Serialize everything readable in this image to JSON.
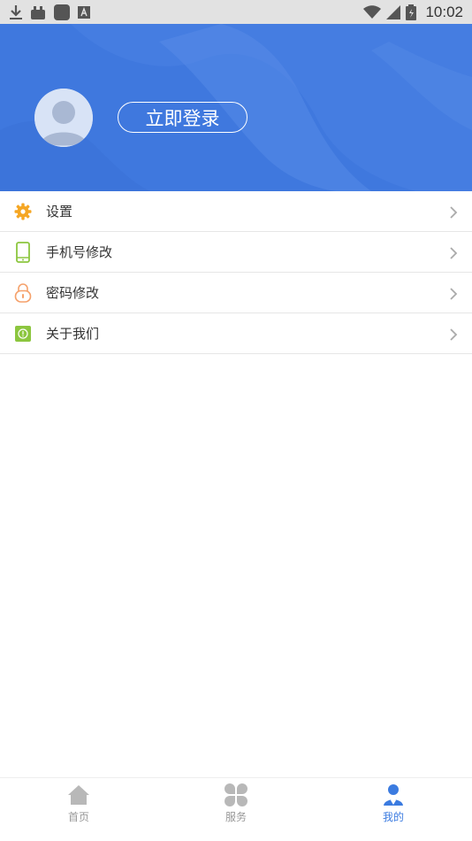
{
  "status_bar": {
    "time": "10:02",
    "icons": [
      "download-icon",
      "app-icon",
      "app-square-icon",
      "font-a-icon",
      "wifi-icon",
      "signal-icon",
      "battery-icon"
    ]
  },
  "header": {
    "login_label": "立即登录",
    "banner_color": "#3f78de"
  },
  "menu": {
    "items": [
      {
        "label": "设置",
        "icon": "gear-icon",
        "color": "#f5a623"
      },
      {
        "label": "手机号修改",
        "icon": "phone-icon",
        "color": "#8cc63f"
      },
      {
        "label": "密码修改",
        "icon": "lock-icon",
        "color": "#f5a16b"
      },
      {
        "label": "关于我们",
        "icon": "info-icon",
        "color": "#8cc63f"
      }
    ]
  },
  "bottom_nav": {
    "tabs": [
      {
        "label": "首页",
        "icon": "home-icon",
        "active": false
      },
      {
        "label": "服务",
        "icon": "grid-icon",
        "active": false
      },
      {
        "label": "我的",
        "icon": "user-icon",
        "active": true
      }
    ],
    "active_color": "#3b7be0",
    "inactive_color": "#999999"
  }
}
